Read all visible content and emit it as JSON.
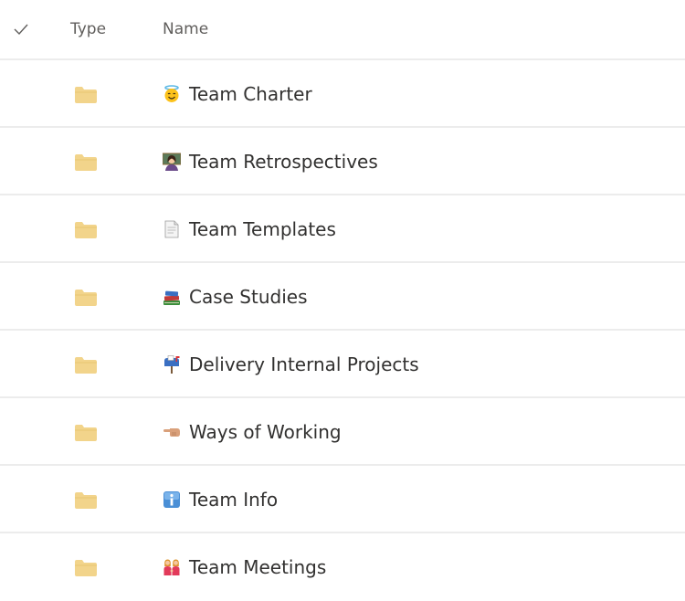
{
  "header": {
    "type_label": "Type",
    "name_label": "Name"
  },
  "rows": [
    {
      "name": "Team Charter",
      "type_icon": "folder-icon",
      "emoji": "smiling-face-with-halo"
    },
    {
      "name": "Team Retrospectives",
      "type_icon": "folder-icon",
      "emoji": "woman-teacher"
    },
    {
      "name": "Team Templates",
      "type_icon": "folder-icon",
      "emoji": "page-facing-up"
    },
    {
      "name": "Case Studies",
      "type_icon": "folder-icon",
      "emoji": "books"
    },
    {
      "name": "Delivery Internal Projects",
      "type_icon": "folder-icon",
      "emoji": "mailbox-with-mail"
    },
    {
      "name": "Ways of Working",
      "type_icon": "folder-icon",
      "emoji": "backhand-index-pointing-left"
    },
    {
      "name": "Team Info",
      "type_icon": "folder-icon",
      "emoji": "information"
    },
    {
      "name": "Team Meetings",
      "type_icon": "folder-icon",
      "emoji": "women-holding-hands"
    }
  ],
  "colors": {
    "folder": "#f2d48b",
    "divider": "#ececec",
    "text": "#323130",
    "header_text": "#605e5c"
  }
}
